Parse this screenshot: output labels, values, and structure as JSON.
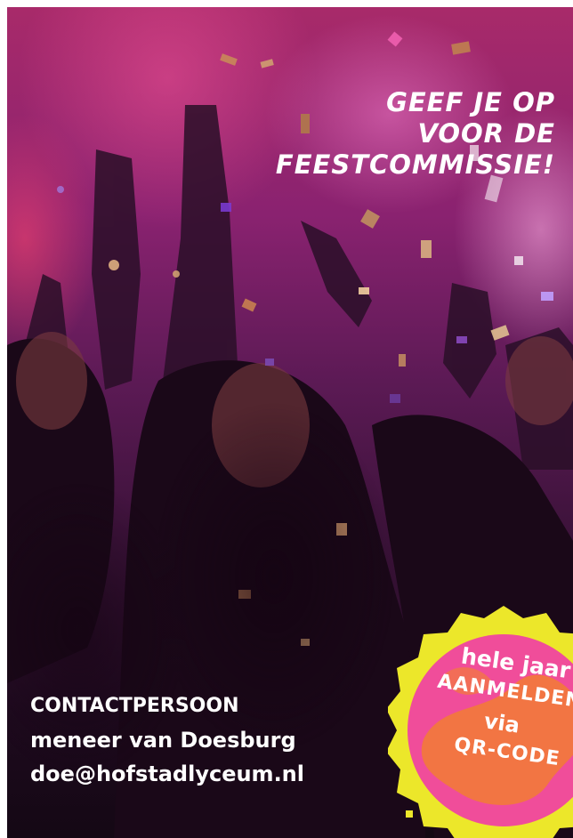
{
  "headline": {
    "line1": "GEEF JE OP",
    "line2": "VOOR DE",
    "line3": "FEESTCOMMISSIE!"
  },
  "contact": {
    "label": "CONTACTPERSOON",
    "name": "meneer van Doesburg",
    "email": "doe@hofstadlyceum.nl"
  },
  "badge": {
    "line1": "hele jaar",
    "line2": "AANMELDEN",
    "line3": "via",
    "line4": "QR-CODE"
  },
  "colors": {
    "badge_ring": "#ece72a",
    "badge_fill": "#f04d9a",
    "badge_splash": "#f27a3a",
    "text": "#ffffff"
  }
}
